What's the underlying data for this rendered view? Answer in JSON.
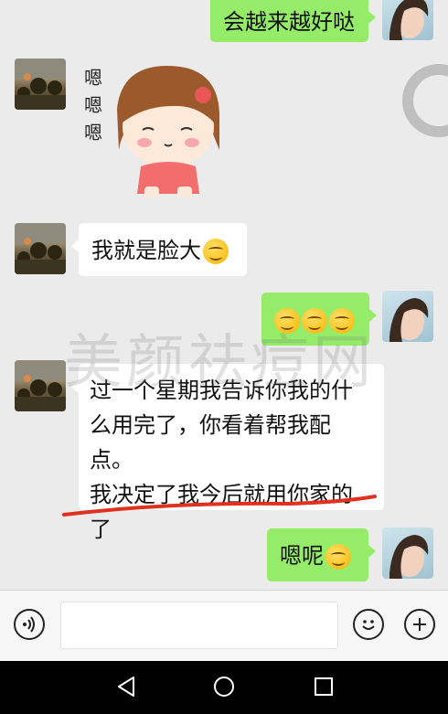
{
  "chat": {
    "messages": [
      {
        "side": "out",
        "text": "会越来越好哒"
      },
      {
        "side": "in",
        "type": "sticker",
        "sticker_text": [
          "嗯",
          "嗯",
          "嗯"
        ]
      },
      {
        "side": "in",
        "text": "我就是脸大",
        "emoji": "thinking-emoji"
      },
      {
        "side": "out",
        "type": "emojis",
        "emoji": "smile-emoji",
        "count": 3
      },
      {
        "side": "in",
        "lines": [
          "过一个星期我告诉你我的什",
          "么用完了，你看着帮我配点。",
          "我决定了我今后就用你家的",
          "了"
        ]
      },
      {
        "side": "out",
        "text": "嗯呢",
        "emoji": "smile-emoji"
      }
    ]
  },
  "watermark": "美颜祛痘网",
  "colors": {
    "outgoing_bubble": "#95ec69",
    "incoming_bubble": "#ffffff",
    "background": "#ebebeb",
    "underline": "#e0301e"
  },
  "input_bar": {
    "voice_icon": "voice-icon",
    "emoji_icon": "emoji-icon",
    "plus_icon": "plus-icon"
  },
  "nav_bar": {
    "back_icon": "back-icon",
    "home_icon": "home-icon",
    "recents_icon": "recents-icon"
  }
}
